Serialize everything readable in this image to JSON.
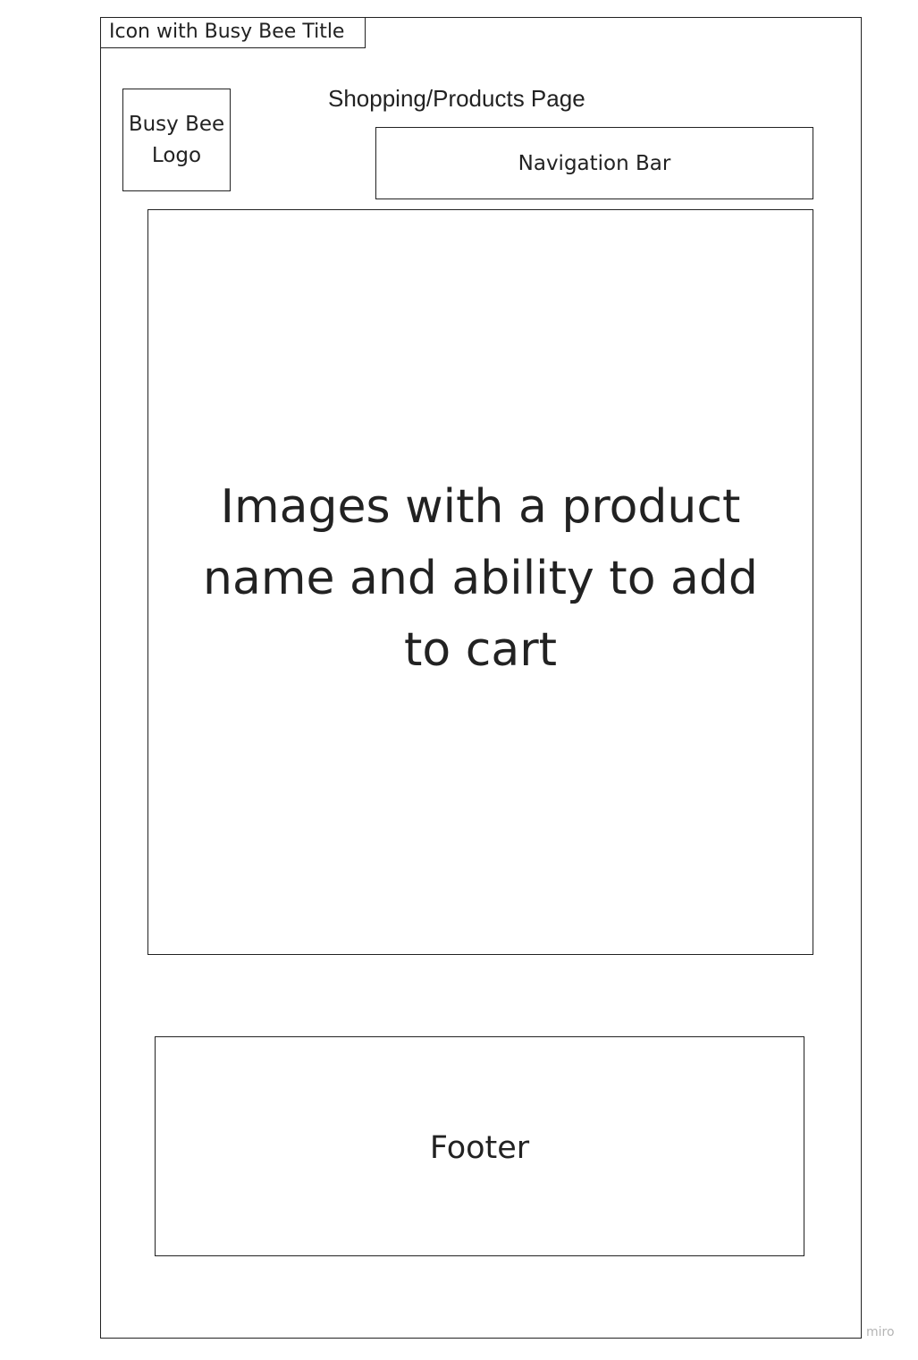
{
  "header": {
    "tab_title": "Icon with Busy Bee Title",
    "logo_text": "Busy Bee\nLogo",
    "page_title": "Shopping/Products Page",
    "nav_label": "Navigation Bar"
  },
  "main": {
    "products_text": "Images with a product name and ability to add to cart"
  },
  "footer": {
    "label": "Footer"
  },
  "watermark": "miro",
  "colors": {
    "stroke": "#222222",
    "background": "#ffffff",
    "watermark": "#b5b5b5"
  }
}
